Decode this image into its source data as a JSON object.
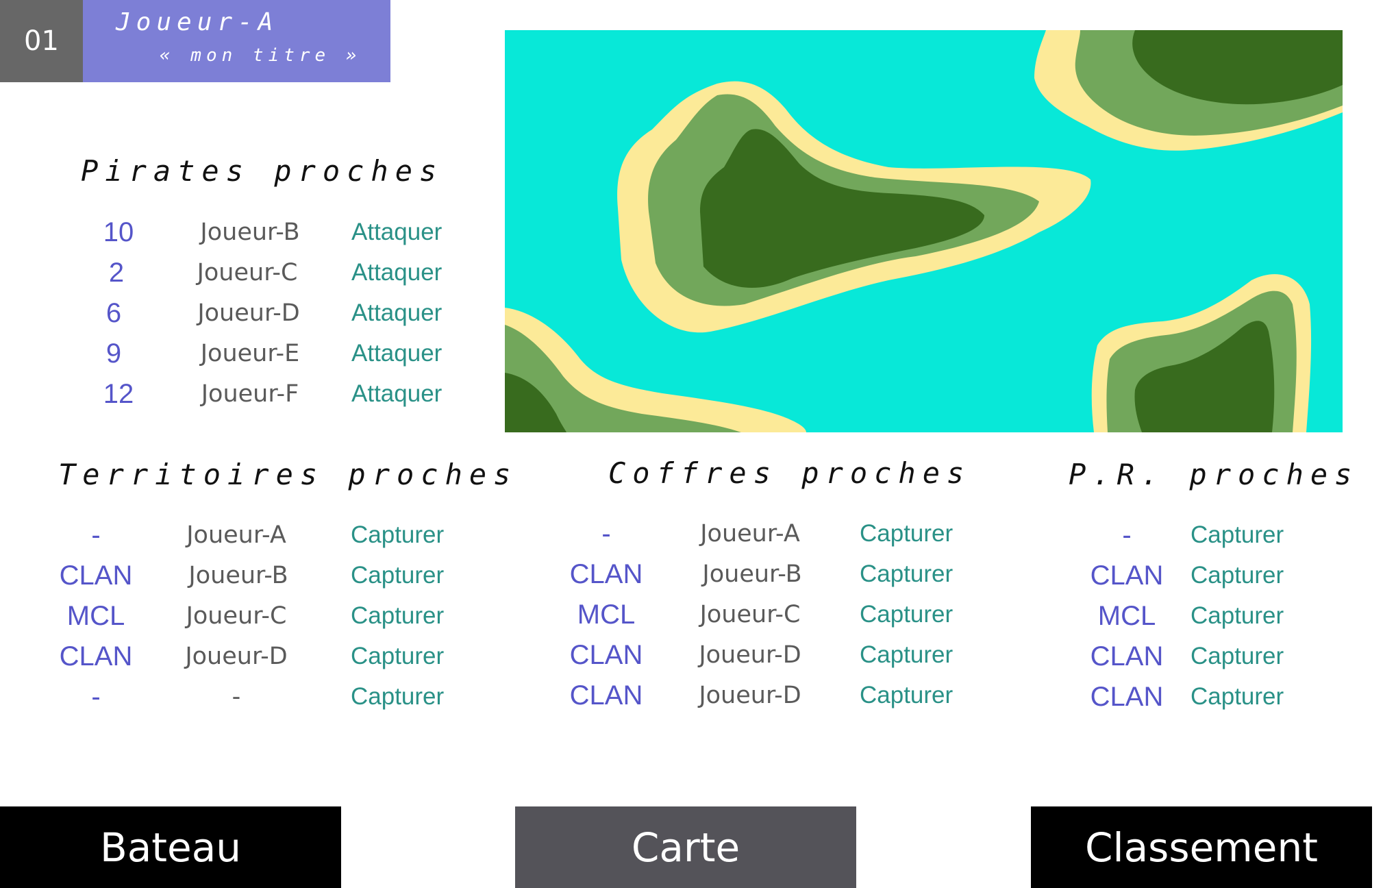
{
  "header": {
    "number": "01",
    "player_name": "Joueur-A",
    "player_title": "« mon titre »"
  },
  "pirates": {
    "title": "Pirates proches",
    "rows": [
      {
        "value": "10",
        "name": "Joueur-B",
        "action": "Attaquer"
      },
      {
        "value": "2",
        "name": "Joueur-C",
        "action": "Attaquer"
      },
      {
        "value": "6",
        "name": "Joueur-D",
        "action": "Attaquer"
      },
      {
        "value": "9",
        "name": "Joueur-E",
        "action": "Attaquer"
      },
      {
        "value": "12",
        "name": "Joueur-F",
        "action": "Attaquer"
      }
    ]
  },
  "territoires": {
    "title": "Territoires proches",
    "rows": [
      {
        "clan": "-",
        "name": "Joueur-A",
        "action": "Capturer"
      },
      {
        "clan": "CLAN",
        "name": "Joueur-B",
        "action": "Capturer"
      },
      {
        "clan": "MCL",
        "name": "Joueur-C",
        "action": "Capturer"
      },
      {
        "clan": "CLAN",
        "name": "Joueur-D",
        "action": "Capturer"
      },
      {
        "clan": "-",
        "name": "-",
        "action": "Capturer"
      }
    ]
  },
  "coffres": {
    "title": "Coffres proches",
    "rows": [
      {
        "clan": "-",
        "name": "Joueur-A",
        "action": "Capturer"
      },
      {
        "clan": "CLAN",
        "name": "Joueur-B",
        "action": "Capturer"
      },
      {
        "clan": "MCL",
        "name": "Joueur-C",
        "action": "Capturer"
      },
      {
        "clan": "CLAN",
        "name": "Joueur-D",
        "action": "Capturer"
      },
      {
        "clan": "CLAN",
        "name": "Joueur-D",
        "action": "Capturer"
      }
    ]
  },
  "pr": {
    "title": "P.R. proches",
    "rows": [
      {
        "clan": "-",
        "action": "Capturer"
      },
      {
        "clan": "CLAN",
        "action": "Capturer"
      },
      {
        "clan": "MCL",
        "action": "Capturer"
      },
      {
        "clan": "CLAN",
        "action": "Capturer"
      },
      {
        "clan": "CLAN",
        "action": "Capturer"
      }
    ]
  },
  "nav": {
    "bateau": "Bateau",
    "carte": "Carte",
    "classement": "Classement"
  },
  "colors": {
    "header_box": "#7d7fd6",
    "header_number": "#676767",
    "value_text": "#5555c9",
    "action_text": "#2a9187",
    "sea": "#08e8d8",
    "sand": "#fcea98",
    "grass": "#72a75b",
    "forest": "#386b1e",
    "button_dark": "#000000",
    "button_active": "#545359"
  }
}
